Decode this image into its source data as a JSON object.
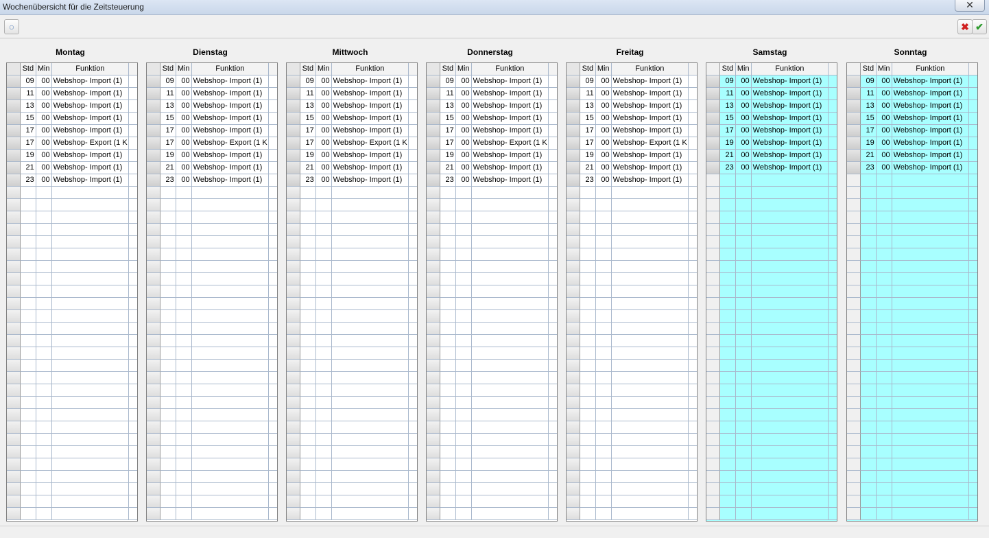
{
  "window": {
    "title": "Wochenübersicht für die Zeitsteuerung",
    "close_label": "✕"
  },
  "toolbar": {
    "hint_icon": "lightbulb-icon",
    "cancel_icon": "red-x-icon",
    "ok_icon": "green-check-icon"
  },
  "columns": {
    "std": "Std",
    "min": "Min",
    "funktion": "Funktion"
  },
  "days": [
    {
      "name": "Montag",
      "weekend": false,
      "entries": [
        {
          "std": "09",
          "min": "00",
          "fn": "Webshop- Import (1)"
        },
        {
          "std": "11",
          "min": "00",
          "fn": "Webshop- Import (1)"
        },
        {
          "std": "13",
          "min": "00",
          "fn": "Webshop- Import (1)"
        },
        {
          "std": "15",
          "min": "00",
          "fn": "Webshop- Import (1)"
        },
        {
          "std": "17",
          "min": "00",
          "fn": "Webshop- Import (1)"
        },
        {
          "std": "17",
          "min": "00",
          "fn": "Webshop- Export (1 K"
        },
        {
          "std": "19",
          "min": "00",
          "fn": "Webshop- Import (1)"
        },
        {
          "std": "21",
          "min": "00",
          "fn": "Webshop- Import (1)"
        },
        {
          "std": "23",
          "min": "00",
          "fn": "Webshop- Import (1)"
        }
      ]
    },
    {
      "name": "Dienstag",
      "weekend": false,
      "entries": [
        {
          "std": "09",
          "min": "00",
          "fn": "Webshop- Import (1)"
        },
        {
          "std": "11",
          "min": "00",
          "fn": "Webshop- Import (1)"
        },
        {
          "std": "13",
          "min": "00",
          "fn": "Webshop- Import (1)"
        },
        {
          "std": "15",
          "min": "00",
          "fn": "Webshop- Import (1)"
        },
        {
          "std": "17",
          "min": "00",
          "fn": "Webshop- Import (1)"
        },
        {
          "std": "17",
          "min": "00",
          "fn": "Webshop- Export (1 K"
        },
        {
          "std": "19",
          "min": "00",
          "fn": "Webshop- Import (1)"
        },
        {
          "std": "21",
          "min": "00",
          "fn": "Webshop- Import (1)"
        },
        {
          "std": "23",
          "min": "00",
          "fn": "Webshop- Import (1)"
        }
      ]
    },
    {
      "name": "Mittwoch",
      "weekend": false,
      "entries": [
        {
          "std": "09",
          "min": "00",
          "fn": "Webshop- Import (1)"
        },
        {
          "std": "11",
          "min": "00",
          "fn": "Webshop- Import (1)"
        },
        {
          "std": "13",
          "min": "00",
          "fn": "Webshop- Import (1)"
        },
        {
          "std": "15",
          "min": "00",
          "fn": "Webshop- Import (1)"
        },
        {
          "std": "17",
          "min": "00",
          "fn": "Webshop- Import (1)"
        },
        {
          "std": "17",
          "min": "00",
          "fn": "Webshop- Export (1 K"
        },
        {
          "std": "19",
          "min": "00",
          "fn": "Webshop- Import (1)"
        },
        {
          "std": "21",
          "min": "00",
          "fn": "Webshop- Import (1)"
        },
        {
          "std": "23",
          "min": "00",
          "fn": "Webshop- Import (1)"
        }
      ]
    },
    {
      "name": "Donnerstag",
      "weekend": false,
      "entries": [
        {
          "std": "09",
          "min": "00",
          "fn": "Webshop- Import (1)"
        },
        {
          "std": "11",
          "min": "00",
          "fn": "Webshop- Import (1)"
        },
        {
          "std": "13",
          "min": "00",
          "fn": "Webshop- Import (1)"
        },
        {
          "std": "15",
          "min": "00",
          "fn": "Webshop- Import (1)"
        },
        {
          "std": "17",
          "min": "00",
          "fn": "Webshop- Import (1)"
        },
        {
          "std": "17",
          "min": "00",
          "fn": "Webshop- Export (1 K"
        },
        {
          "std": "19",
          "min": "00",
          "fn": "Webshop- Import (1)"
        },
        {
          "std": "21",
          "min": "00",
          "fn": "Webshop- Import (1)"
        },
        {
          "std": "23",
          "min": "00",
          "fn": "Webshop- Import (1)"
        }
      ]
    },
    {
      "name": "Freitag",
      "weekend": false,
      "entries": [
        {
          "std": "09",
          "min": "00",
          "fn": "Webshop- Import (1)"
        },
        {
          "std": "11",
          "min": "00",
          "fn": "Webshop- Import (1)"
        },
        {
          "std": "13",
          "min": "00",
          "fn": "Webshop- Import (1)"
        },
        {
          "std": "15",
          "min": "00",
          "fn": "Webshop- Import (1)"
        },
        {
          "std": "17",
          "min": "00",
          "fn": "Webshop- Import (1)"
        },
        {
          "std": "17",
          "min": "00",
          "fn": "Webshop- Export (1 K"
        },
        {
          "std": "19",
          "min": "00",
          "fn": "Webshop- Import (1)"
        },
        {
          "std": "21",
          "min": "00",
          "fn": "Webshop- Import (1)"
        },
        {
          "std": "23",
          "min": "00",
          "fn": "Webshop- Import (1)"
        }
      ]
    },
    {
      "name": "Samstag",
      "weekend": true,
      "entries": [
        {
          "std": "09",
          "min": "00",
          "fn": "Webshop- Import (1)"
        },
        {
          "std": "11",
          "min": "00",
          "fn": "Webshop- Import (1)"
        },
        {
          "std": "13",
          "min": "00",
          "fn": "Webshop- Import (1)"
        },
        {
          "std": "15",
          "min": "00",
          "fn": "Webshop- Import (1)"
        },
        {
          "std": "17",
          "min": "00",
          "fn": "Webshop- Import (1)"
        },
        {
          "std": "19",
          "min": "00",
          "fn": "Webshop- Import (1)"
        },
        {
          "std": "21",
          "min": "00",
          "fn": "Webshop- Import (1)"
        },
        {
          "std": "23",
          "min": "00",
          "fn": "Webshop- Import (1)"
        }
      ]
    },
    {
      "name": "Sonntag",
      "weekend": true,
      "entries": [
        {
          "std": "09",
          "min": "00",
          "fn": "Webshop- Import (1)"
        },
        {
          "std": "11",
          "min": "00",
          "fn": "Webshop- Import (1)"
        },
        {
          "std": "13",
          "min": "00",
          "fn": "Webshop- Import (1)"
        },
        {
          "std": "15",
          "min": "00",
          "fn": "Webshop- Import (1)"
        },
        {
          "std": "17",
          "min": "00",
          "fn": "Webshop- Import (1)"
        },
        {
          "std": "19",
          "min": "00",
          "fn": "Webshop- Import (1)"
        },
        {
          "std": "21",
          "min": "00",
          "fn": "Webshop- Import (1)"
        },
        {
          "std": "23",
          "min": "00",
          "fn": "Webshop- Import (1)"
        }
      ]
    }
  ],
  "colors": {
    "weekend_bg": "#a8ffff",
    "grid_line": "#a9b8cc"
  }
}
